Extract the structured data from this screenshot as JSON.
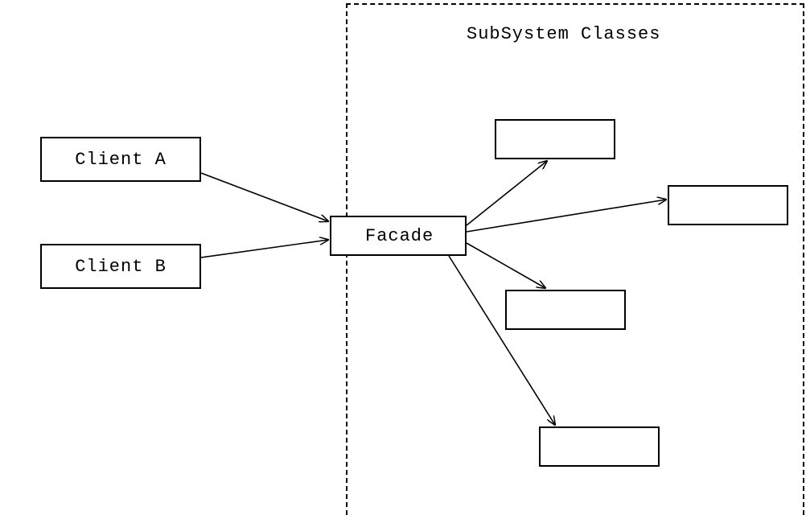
{
  "diagram": {
    "type": "facade-pattern",
    "subsystem_title": "SubSystem Classes",
    "clients": [
      {
        "label": "Client A"
      },
      {
        "label": "Client B"
      }
    ],
    "facade": {
      "label": "Facade"
    },
    "subsystem_boxes": [
      {
        "label": ""
      },
      {
        "label": ""
      },
      {
        "label": ""
      },
      {
        "label": ""
      }
    ],
    "arrows": [
      {
        "from": "client-a",
        "to": "facade"
      },
      {
        "from": "client-b",
        "to": "facade"
      },
      {
        "from": "facade",
        "to": "subsystem-1"
      },
      {
        "from": "facade",
        "to": "subsystem-2"
      },
      {
        "from": "facade",
        "to": "subsystem-3"
      },
      {
        "from": "facade",
        "to": "subsystem-4"
      }
    ]
  }
}
